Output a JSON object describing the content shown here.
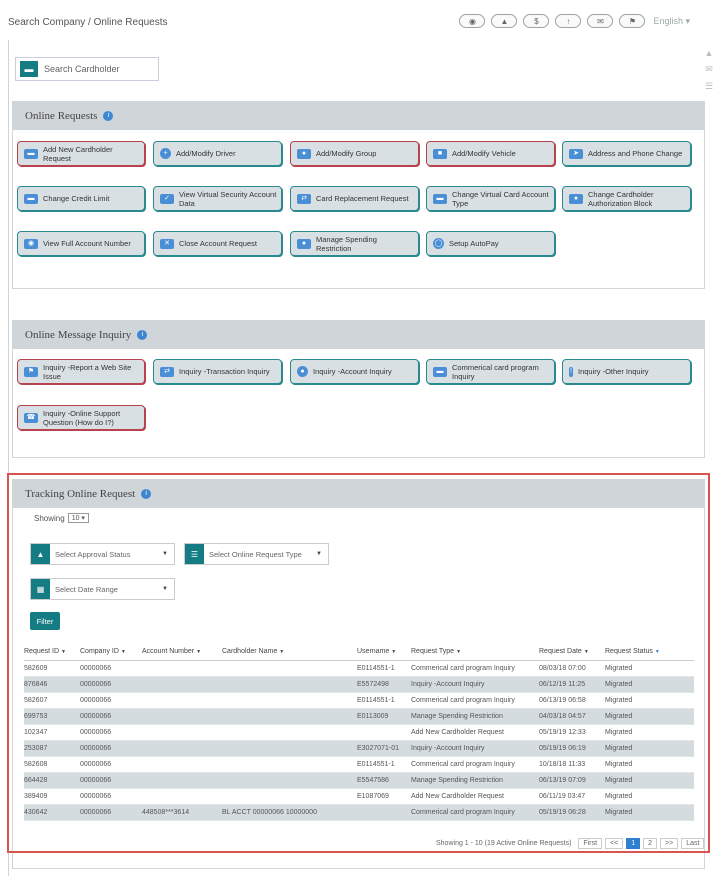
{
  "breadcrumb": "Search Company / Online Requests",
  "language": "English",
  "header_icons": [
    "user-icon",
    "bell-icon",
    "dollar-icon",
    "upload-icon",
    "mail-icon",
    "flag-icon"
  ],
  "search": {
    "placeholder": "Search Cardholder"
  },
  "online_requests": {
    "title": "Online Requests",
    "buttons": [
      "Add New Cardholder Request",
      "Add/Modify Driver",
      "Add/Modify Group",
      "Add/Modify Vehicle",
      "Address and Phone Change",
      "Change Credit Limit",
      "View Virtual Security Account Data",
      "Card Replacement Request",
      "Change Virtual Card Account Type",
      "Change Cardholder Authorization Block",
      "View Full Account Number",
      "Close Account Request",
      "Manage Spending Restriction",
      "Setup AutoPay"
    ]
  },
  "message_inquiry": {
    "title": "Online Message Inquiry",
    "buttons": [
      "Inquiry -Report a Web Site Issue",
      "Inquiry -Transaction Inquiry",
      "Inquiry -Account Inquiry",
      "Commerical card program Inquiry",
      "Inquiry -Other Inquiry",
      "Inquiry -Online Support Question (How do I?)"
    ]
  },
  "tracking": {
    "title": "Tracking Online Request",
    "showing_label": "Showing",
    "showing_value": "10",
    "approval_placeholder": "Select Approval Status",
    "type_placeholder": "Select Online Request Type",
    "date_placeholder": "Select Date Range",
    "filter_label": "Filter",
    "columns": [
      "Request ID",
      "Company ID",
      "Account Number",
      "Cardholder Name",
      "Username",
      "Request Type",
      "Request Date",
      "Request Status"
    ],
    "rows": [
      [
        "582609",
        "00000066",
        "",
        "",
        "E0114551-1",
        "Commerical card program Inquiry",
        "08/03/18 07:00",
        "Migrated"
      ],
      [
        "876846",
        "00000066",
        "",
        "",
        "E5572498",
        "Inquiry -Account Inquiry",
        "06/12/19 11:25",
        "Migrated"
      ],
      [
        "582607",
        "00000066",
        "",
        "",
        "E0114551-1",
        "Commerical card program Inquiry",
        "06/13/19 06:58",
        "Migrated"
      ],
      [
        "699753",
        "00000066",
        "",
        "",
        "E0113009",
        "Manage Spending Restriction",
        "04/03/18 04:57",
        "Migrated"
      ],
      [
        "102347",
        "00000066",
        "",
        "",
        "",
        "Add New Cardholder Request",
        "05/19/19 12:33",
        "Migrated"
      ],
      [
        "253087",
        "00000066",
        "",
        "",
        "E3027071-01",
        "Inquiry -Account Inquiry",
        "05/19/19 06:19",
        "Migrated"
      ],
      [
        "582608",
        "00000066",
        "",
        "",
        "E0114551-1",
        "Commerical card program Inquiry",
        "10/18/18 11:33",
        "Migrated"
      ],
      [
        "664428",
        "00000066",
        "",
        "",
        "E5547586",
        "Manage Spending Restriction",
        "06/13/19 07:09",
        "Migrated"
      ],
      [
        "389409",
        "00000066",
        "",
        "",
        "E1087069",
        "Add New Cardholder Request",
        "06/11/19 03:47",
        "Migrated"
      ],
      [
        "430642",
        "00000066",
        "448508***3614",
        "BL ACCT 00000066 10000000",
        "",
        "Commerical card program Inquiry",
        "05/19/19 06:28",
        "Migrated"
      ]
    ],
    "pagination_text": "Showing 1 - 10 (19 Active Online Requests)",
    "pages": [
      "First",
      "<<",
      "1",
      "2",
      ">>",
      "Last"
    ]
  },
  "colors": {
    "teal": "#167c83",
    "red_border": "#b7434f",
    "highlight": "#d9534f",
    "blue": "#2e7fcf"
  }
}
